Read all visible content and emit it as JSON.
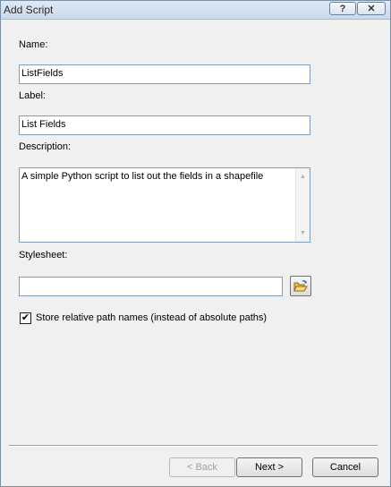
{
  "window": {
    "title": "Add Script",
    "help_label": "?",
    "close_label": "✕"
  },
  "form": {
    "name_label": "Name:",
    "name_value": "ListFields",
    "label_label": "Label:",
    "label_value": "List Fields",
    "description_label": "Description:",
    "description_value": "A simple Python script to list out the fields in a shapefile",
    "stylesheet_label": "Stylesheet:",
    "stylesheet_value": "",
    "relative_paths_label": "Store relative path names (instead of absolute paths)",
    "relative_paths_checked": true,
    "checkmark": "✔"
  },
  "buttons": {
    "back": "< Back",
    "next": "Next >",
    "cancel": "Cancel",
    "back_enabled": false
  },
  "icons": {
    "browse": "folder-open-icon"
  }
}
